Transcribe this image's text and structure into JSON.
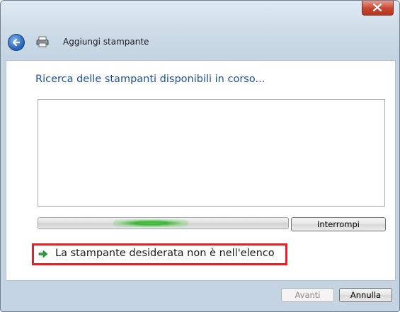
{
  "window": {
    "title": "Aggiungi stampante"
  },
  "content": {
    "heading": "Ricerca delle stampanti disponibili in corso...",
    "progress": 0.45,
    "stop_button": "Interrompi",
    "not_listed_link": "La stampante desiderata non è nell'elenco"
  },
  "footer": {
    "next_button": "Avanti",
    "cancel_button": "Annulla"
  },
  "colors": {
    "heading": "#1c4fa8",
    "highlight_border": "#e32027",
    "progress": "#3fb63c"
  },
  "icons": {
    "close": "close-icon",
    "back": "back-arrow-icon",
    "printer": "printer-icon",
    "link_arrow": "green-arrow-icon"
  }
}
